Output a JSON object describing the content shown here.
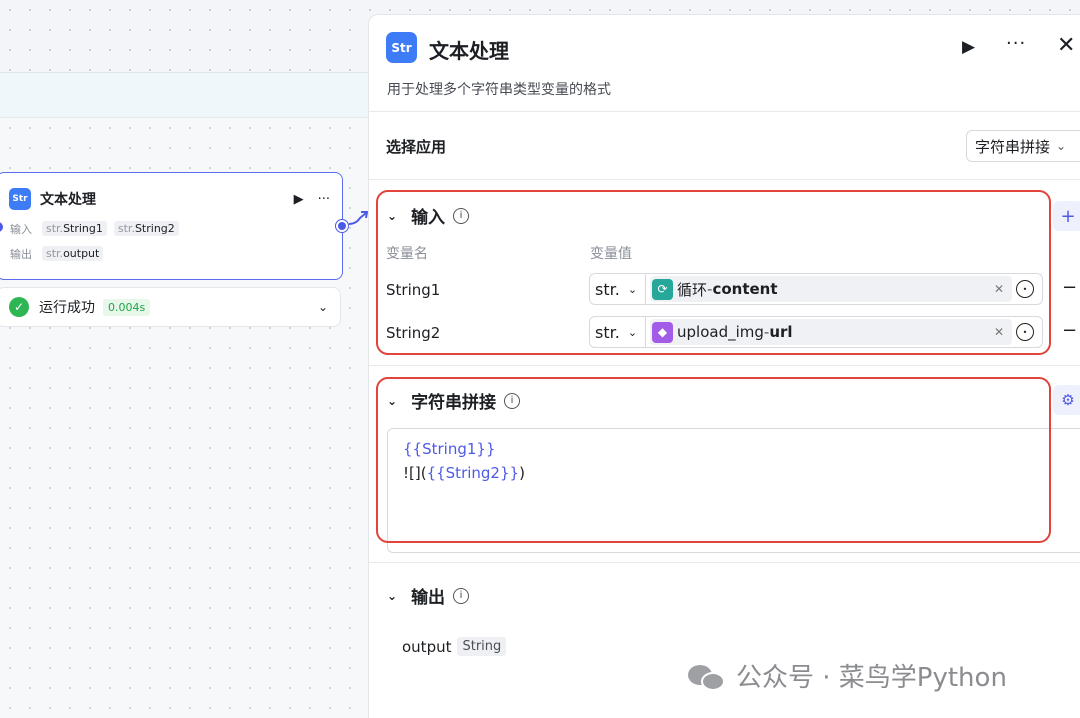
{
  "canvas": {
    "node": {
      "title": "文本处理",
      "input_label": "输入",
      "output_label": "输出",
      "inputs": [
        {
          "prefix": "str.",
          "name": "String1"
        },
        {
          "prefix": "str.",
          "name": "String2"
        }
      ],
      "output": {
        "prefix": "str.",
        "name": "output"
      },
      "run_icon": "play-icon",
      "more_icon": "more-icon"
    },
    "run_status": {
      "text": "运行成功",
      "time": "0.004s"
    }
  },
  "panel": {
    "icon_text": "Str",
    "title": "文本处理",
    "description": "用于处理多个字符串类型变量的格式",
    "select_section": {
      "label": "选择应用",
      "value": "字符串拼接"
    },
    "input_section": {
      "title": "输入",
      "col_name": "变量名",
      "col_value": "变量值",
      "rows": [
        {
          "name": "String1",
          "type": "str.",
          "ref_source": "循环",
          "ref_sep": " - ",
          "ref_field": "content",
          "ref_color": "#25a89a"
        },
        {
          "name": "String2",
          "type": "str.",
          "ref_source": "upload_img",
          "ref_sep": " - ",
          "ref_field": "url",
          "ref_color": "#a25ce8"
        }
      ],
      "add_label": "+",
      "remove_label": "−"
    },
    "concat_section": {
      "title": "字符串拼接",
      "line1_var": "{{String1}}",
      "line2_prefix": "![](",
      "line2_var": "{{String2}}",
      "line2_suffix": ")"
    },
    "output_section": {
      "title": "输出",
      "name": "output",
      "type": "String"
    }
  },
  "watermark": {
    "text": "公众号 · 菜鸟学Python"
  },
  "colors": {
    "accent": "#4d5ae6",
    "highlight_border": "#e0443a",
    "success": "#2fb654"
  }
}
